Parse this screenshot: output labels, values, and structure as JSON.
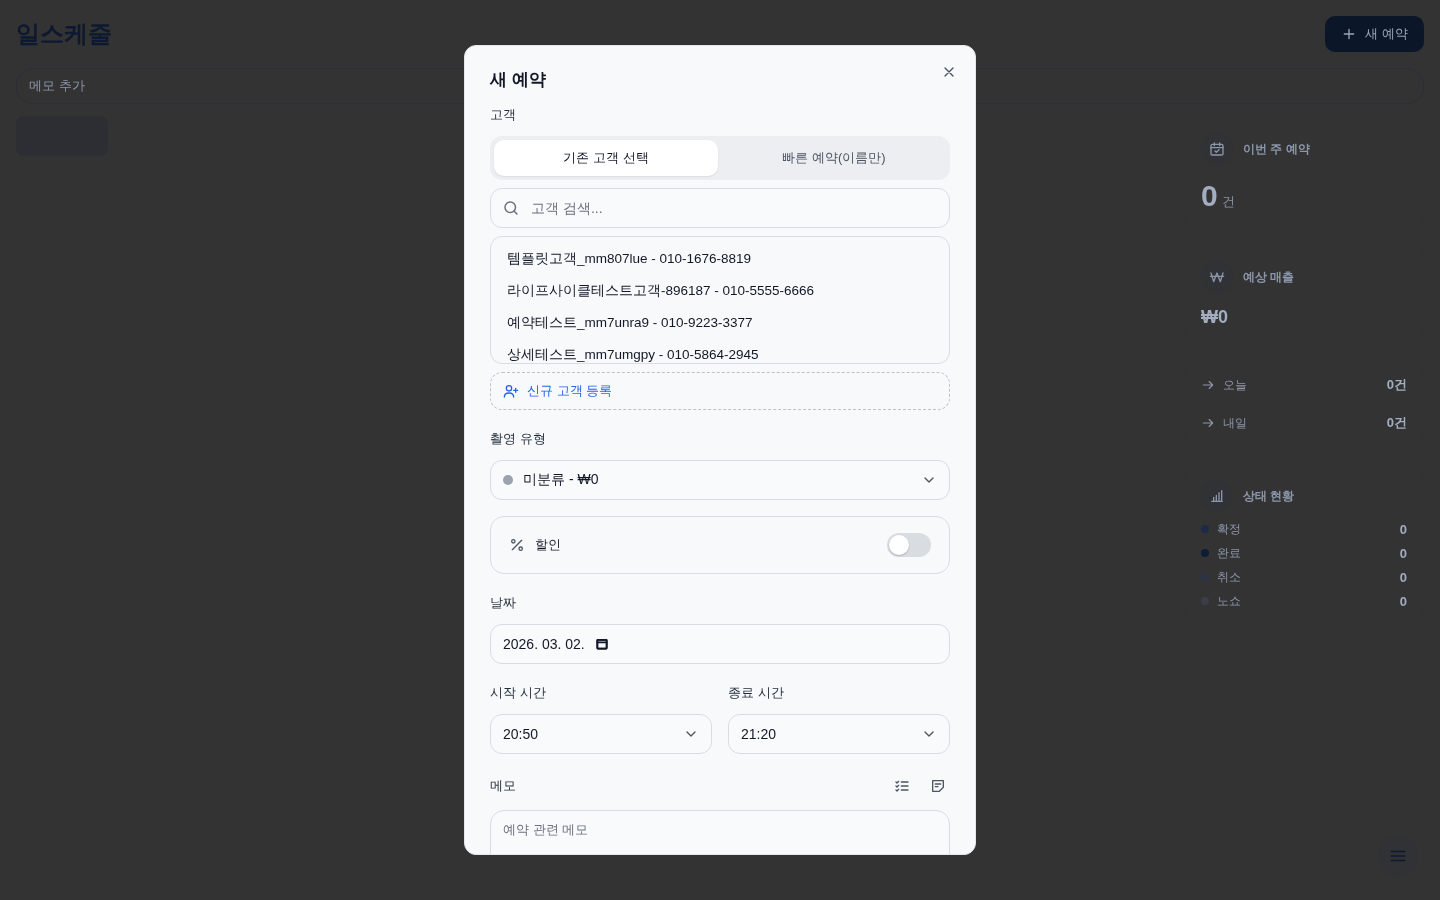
{
  "app": {
    "title": "일스케줄",
    "new_button": "새 예약",
    "memo_bar": "메모 추가"
  },
  "stats": {
    "week": {
      "label": "이번 주 예약",
      "value": "0",
      "unit": "건"
    },
    "revenue": {
      "label": "예상 매출",
      "value": "₩0"
    },
    "upcoming": [
      {
        "label": "오늘",
        "value": "0건"
      },
      {
        "label": "내일",
        "value": "0건"
      }
    ],
    "status": {
      "title": "상태 현황",
      "items": [
        {
          "label": "확정",
          "value": "0",
          "color": "#1b2a48"
        },
        {
          "label": "완료",
          "value": "0",
          "color": "#0f1c36"
        },
        {
          "label": "취소",
          "value": "0",
          "color": "#2b3346"
        },
        {
          "label": "노쇼",
          "value": "0",
          "color": "#3a3e48"
        }
      ]
    }
  },
  "modal": {
    "title": "새 예약",
    "customer_label": "고객",
    "tabs": [
      {
        "label": "기존 고객 선택",
        "selected": true
      },
      {
        "label": "빠른 예약(이름만)",
        "selected": false
      }
    ],
    "search": {
      "placeholder": "고객 검색..."
    },
    "customers": [
      "템플릿고객_mm807lue - 010-1676-8819",
      "라이프사이클테스트고객-896187 - 010-5555-6666",
      "예약테스트_mm7unra9 - 010-9223-3377",
      "상세테스트_mm7umgpy - 010-5864-2945"
    ],
    "add_customer": "신규 고객 등록",
    "type_label": "촬영 유형",
    "type": {
      "value": "미분류 - ₩0",
      "color": "#9ca3af"
    },
    "discount": {
      "label": "할인",
      "on": false
    },
    "date_label": "날짜",
    "date": "2026. 03. 02.",
    "start_label": "시작 시간",
    "start": "20:50",
    "end_label": "종료 시간",
    "end": "21:20",
    "memo_label": "메모",
    "memo": {
      "placeholder": "예약 관련 메모"
    }
  }
}
